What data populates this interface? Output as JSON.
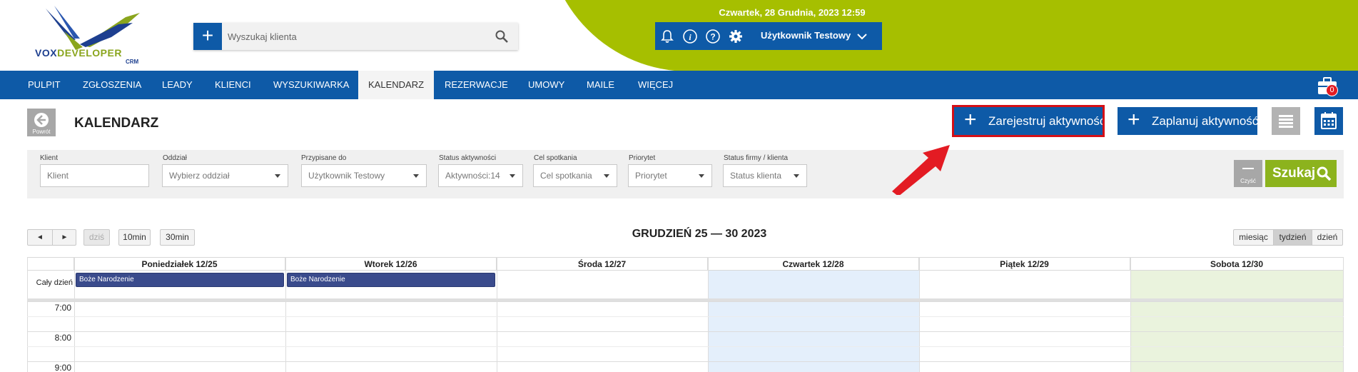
{
  "header": {
    "logo": {
      "text_vox": "VOX",
      "text_developer": "DEVELOPER",
      "text_crm": "CRM"
    },
    "search": {
      "placeholder": "Wyszukaj klienta",
      "add_icon": "plus-icon",
      "search_icon": "magnifier-icon"
    },
    "datetime": "Czwartek, 28 Grudnia, 2023   12:59",
    "user": {
      "name": "Użytkownik Testowy",
      "icons": [
        "bell-icon",
        "info-icon",
        "help-icon",
        "gear-icon",
        "chevron-down-icon"
      ]
    },
    "colors": {
      "brand_blue": "#0e5aa7",
      "lime": "#a6bf00"
    }
  },
  "nav": {
    "items": [
      "PULPIT",
      "ZGŁOSZENIA",
      "LEADY",
      "KLIENCI",
      "WYSZUKIWARKA",
      "KALENDARZ",
      "REZERWACJE",
      "UMOWY",
      "MAILE",
      "WIĘCEJ"
    ],
    "active": "KALENDARZ",
    "briefcase_badge": "0"
  },
  "page": {
    "back_label": "Powrót",
    "title": "KALENDARZ",
    "register_activity": "Zarejestruj aktywność",
    "plan_activity": "Zaplanuj aktywność"
  },
  "filters": {
    "client": {
      "label": "Klient",
      "placeholder": "Klient"
    },
    "branch": {
      "label": "Oddział",
      "value": "Wybierz oddział"
    },
    "assigned": {
      "label": "Przypisane do",
      "value": "Użytkownik Testowy"
    },
    "status": {
      "label": "Status aktywności",
      "value": "Aktywności:14"
    },
    "goal": {
      "label": "Cel spotkania",
      "value": "Cel spotkania"
    },
    "priority": {
      "label": "Priorytet",
      "value": "Priorytet"
    },
    "company_status": {
      "label": "Status firmy / klienta",
      "value": "Status klienta"
    },
    "clear_label": "Czyść",
    "search_label": "Szukaj"
  },
  "calendar": {
    "prev": "◄",
    "next": "►",
    "today": "dziś",
    "slot10": "10min",
    "slot30": "30min",
    "title": "GRUDZIEŃ 25 — 30 2023",
    "views": [
      "miesiąc",
      "tydzień",
      "dzień"
    ],
    "active_view": "tydzień",
    "days": [
      "Poniedziałek 12/25",
      "Wtorek 12/26",
      "Środa 12/27",
      "Czwartek 12/28",
      "Piątek 12/29",
      "Sobota 12/30"
    ],
    "all_day_label": "Cały dzień",
    "events": [
      {
        "title": "Boże Narodzenie",
        "day": 0
      },
      {
        "title": "Boże Narodzenie",
        "day": 1
      }
    ],
    "times": [
      "7:00",
      "8:00",
      "9:00"
    ]
  }
}
